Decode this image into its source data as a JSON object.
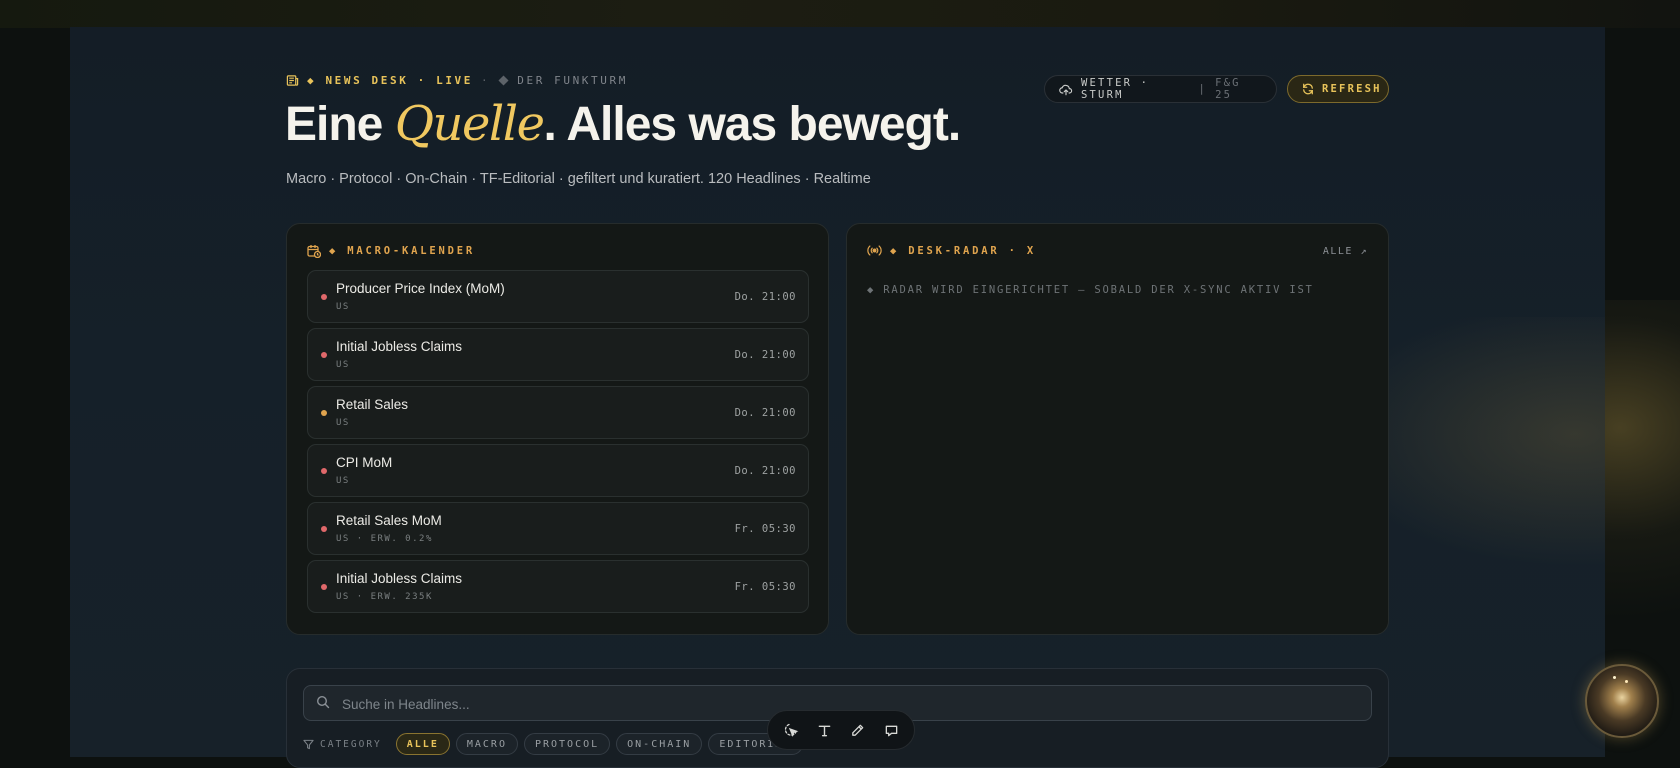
{
  "eyebrow": {
    "label": "◆ NEWS DESK · LIVE",
    "separator": "·",
    "secondary": "DER FUNKTURM"
  },
  "hero": {
    "title_pre": "Eine ",
    "title_em": "Quelle",
    "title_post": ". Alles was bewegt.",
    "subtitle": "Macro · Protocol · On-Chain · TF-Editorial · gefiltert und kuratiert. 120 Headlines · Realtime"
  },
  "status_pill": {
    "weather": "WETTER · STURM",
    "divider": "|",
    "fear_greed": "F&G 25"
  },
  "refresh_button": {
    "label": "REFRESH"
  },
  "macro_calendar": {
    "title": "◆ MACRO-KALENDER",
    "events": [
      {
        "name": "Producer Price Index (MoM)",
        "meta": "US",
        "time": "Do. 21:00",
        "impact": "high",
        "color": "#e0686a"
      },
      {
        "name": "Initial Jobless Claims",
        "meta": "US",
        "time": "Do. 21:00",
        "impact": "high",
        "color": "#e0686a"
      },
      {
        "name": "Retail Sales",
        "meta": "US",
        "time": "Do. 21:00",
        "impact": "medium",
        "color": "#e0a44e"
      },
      {
        "name": "CPI MoM",
        "meta": "US",
        "time": "Do. 21:00",
        "impact": "high",
        "color": "#e0686a"
      },
      {
        "name": "Retail Sales MoM",
        "meta": "US · ERW. 0.2%",
        "time": "Fr. 05:30",
        "impact": "high",
        "color": "#e0686a"
      },
      {
        "name": "Initial Jobless Claims",
        "meta": "US · ERW. 235K",
        "time": "Fr. 05:30",
        "impact": "high",
        "color": "#e0686a"
      }
    ]
  },
  "desk_radar": {
    "title": "◆ DESK-RADAR · X",
    "all_link": "ALLE ↗",
    "message": "◆ RADAR WIRD EINGERICHTET — SOBALD DER X-SYNC AKTIV IST"
  },
  "search": {
    "placeholder": "Suche in Headlines...",
    "value": ""
  },
  "categories": {
    "label": "CATEGORY",
    "chips": [
      "ALLE",
      "MACRO",
      "PROTOCOL",
      "ON-CHAIN",
      "EDITORIAL"
    ],
    "active": "ALLE"
  },
  "toolbar": {
    "tools": [
      "select-icon",
      "text-icon",
      "pen-icon",
      "comment-icon"
    ]
  },
  "colors": {
    "accent_gold": "#e8c35a",
    "accent_orange": "#e0a44e",
    "impact_high": "#e0686a",
    "background": "#141d26"
  }
}
